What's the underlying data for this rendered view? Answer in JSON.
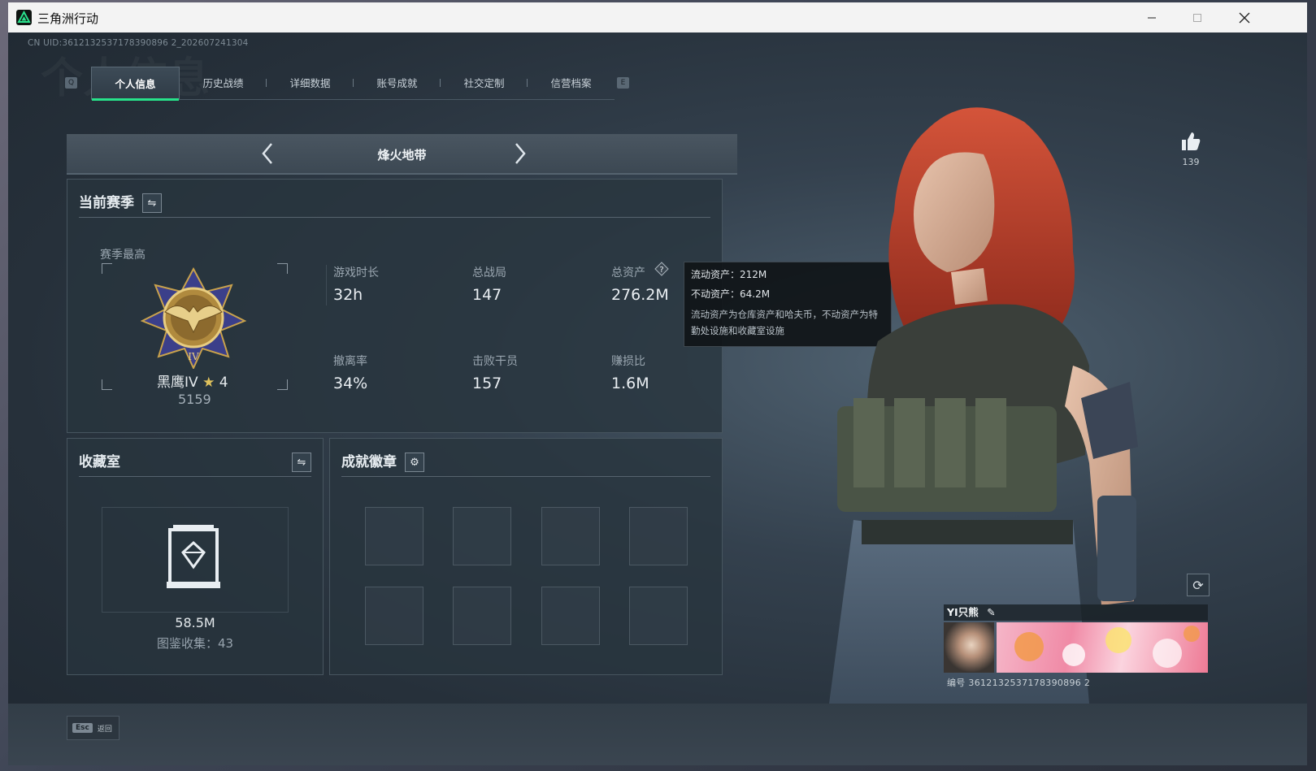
{
  "window": {
    "title": "三角洲行动",
    "uid": "CN UID:3612132537178390896 2_202607241304",
    "watermark": "个人信息"
  },
  "keys": {
    "prev_tab": "Q",
    "next_tab": "E"
  },
  "tabs": [
    {
      "label": "个人信息",
      "active": true
    },
    {
      "label": "历史战绩"
    },
    {
      "label": "详细数据"
    },
    {
      "label": "账号成就"
    },
    {
      "label": "社交定制"
    },
    {
      "label": "信营档案"
    }
  ],
  "mode": {
    "title": "烽火地带"
  },
  "season": {
    "title": "当前赛季",
    "best_label": "赛季最高",
    "rank_name": "黑鹰IV",
    "rank_stars": "4",
    "rank_score": "5159",
    "rank_roman": "IV",
    "stats": [
      {
        "label": "游戏时长",
        "value": "32h"
      },
      {
        "label": "总战局",
        "value": "147"
      },
      {
        "label": "总资产",
        "value": "276.2M"
      },
      {
        "label": "撤离率",
        "value": "34%"
      },
      {
        "label": "击败干员",
        "value": "157"
      },
      {
        "label": "赚损比",
        "value": "1.6M"
      }
    ]
  },
  "tooltip": {
    "liquid": "流动资产：212M",
    "fixed": "不动资产：64.2M",
    "note": "流动资产为仓库资产和哈夫币，不动资产为特勤处设施和收藏室设施"
  },
  "collection": {
    "title": "收藏室",
    "value": "58.5M",
    "count": "图鉴收集：43"
  },
  "badges": {
    "title": "成就徽章",
    "slots": 8
  },
  "profile": {
    "likes": "139",
    "player_name": "YI只熊",
    "player_id": "编号 3612132537178390896 2"
  },
  "footer": {
    "esc_key": "Esc",
    "esc_label": "返回"
  },
  "colors": {
    "accent": "#27e28a",
    "panel": "#28343e",
    "hair": "#c8452e"
  }
}
